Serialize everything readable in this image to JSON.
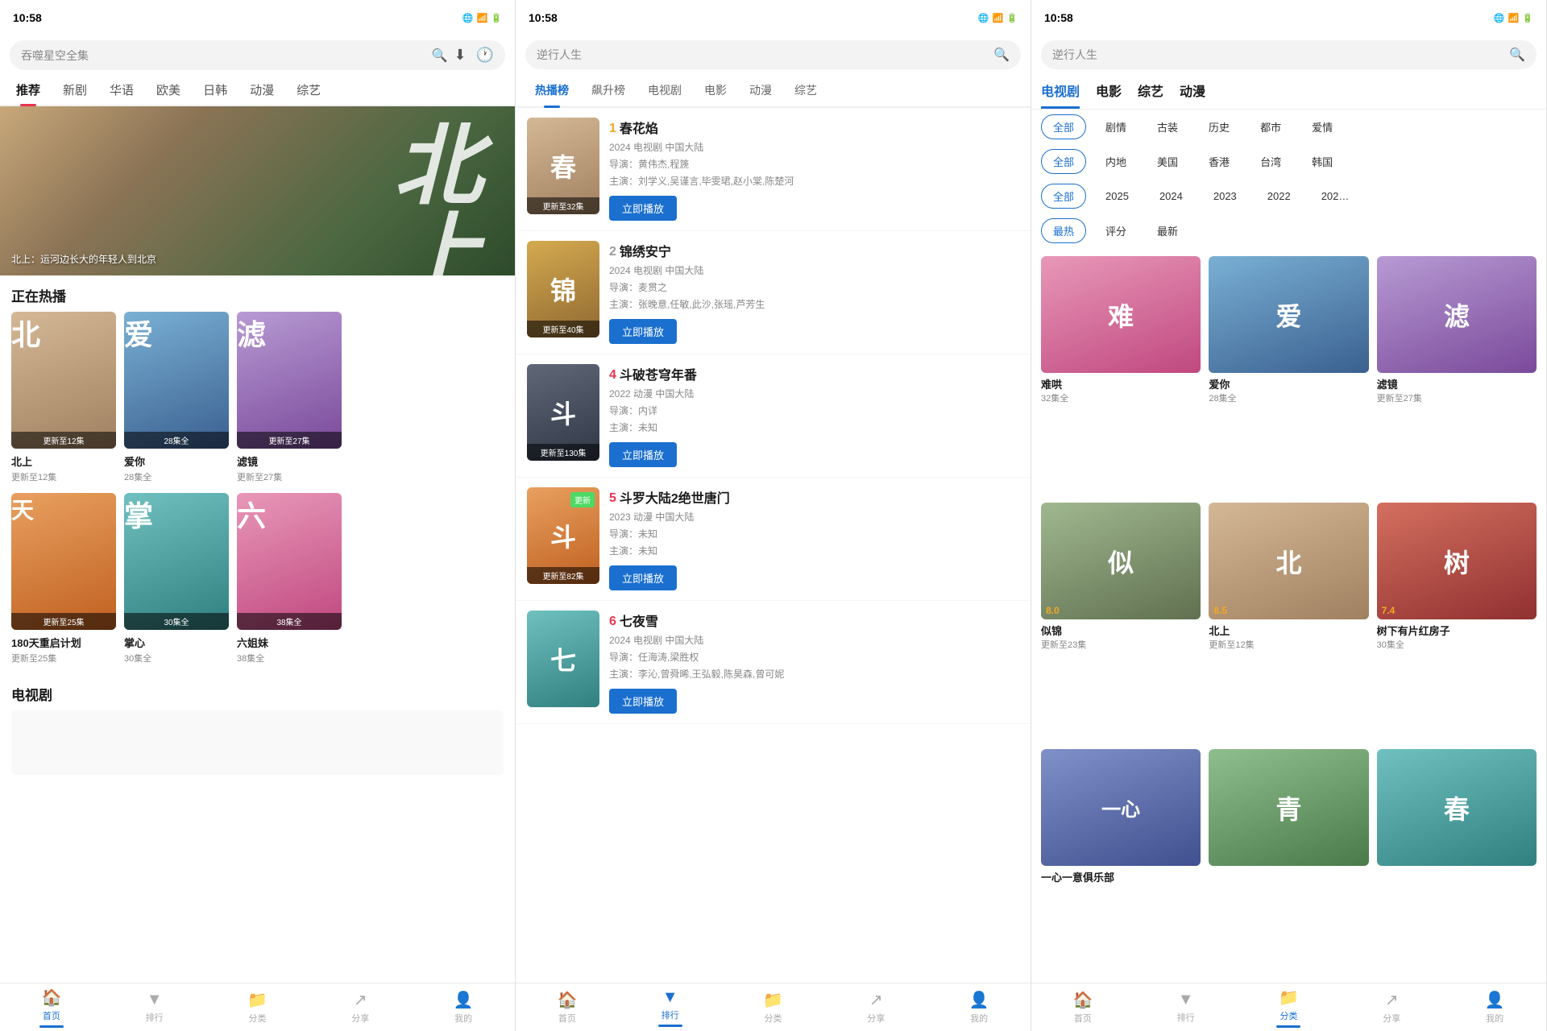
{
  "panels": [
    {
      "id": "home",
      "statusTime": "10:58",
      "searchPlaceholder": "吞噬星空全集",
      "tabs": [
        "推荐",
        "新剧",
        "华语",
        "欧美",
        "日韩",
        "动漫",
        "综艺"
      ],
      "activeTab": 0,
      "heroBigChar": "北上",
      "heroSubtitle": "北上：运河边长大的年轻人到北京",
      "nowPlaying": "正在热播",
      "hotShows": [
        {
          "title": "北上",
          "sub": "更新至12集",
          "color": "img-beige",
          "char": "北"
        },
        {
          "title": "爱你",
          "sub": "28集全",
          "color": "img-blue",
          "char": "爱"
        },
        {
          "title": "滤镜",
          "sub": "更新至27集",
          "color": "img-purple",
          "char": "滤"
        }
      ],
      "hotShows2": [
        {
          "title": "180天重启计划",
          "sub": "更新至25集",
          "color": "img-orange",
          "char": "天"
        },
        {
          "title": "掌心",
          "sub": "30集全",
          "color": "img-teal",
          "char": "掌"
        },
        {
          "title": "六姐妹",
          "sub": "38集全",
          "color": "img-pink",
          "char": "六"
        }
      ],
      "tvSection": "电视剧",
      "bottomNav": [
        {
          "icon": "🏠",
          "label": "首页",
          "active": true
        },
        {
          "icon": "📊",
          "label": "排行",
          "active": false
        },
        {
          "icon": "📁",
          "label": "分类",
          "active": false
        },
        {
          "icon": "↗",
          "label": "分享",
          "active": false
        },
        {
          "icon": "👤",
          "label": "我的",
          "active": false
        }
      ]
    },
    {
      "id": "rank",
      "statusTime": "10:58",
      "searchPlaceholder": "逆行人生",
      "rankTabs": [
        "热播榜",
        "飙升榜",
        "电视剧",
        "电影",
        "动漫",
        "综艺"
      ],
      "activeRankTab": 0,
      "items": [
        {
          "rank": "1",
          "title": "春花焰",
          "meta1": "2024  电视剧  中国大陆",
          "meta2": "导演：黄伟杰,程篪",
          "meta3": "主演：刘学义,吴谨言,毕雯珺,赵小棠,陈楚河",
          "updateBadge": "更新至32集",
          "color": "img-beige",
          "char": "春",
          "btnLabel": "立即播放"
        },
        {
          "rank": "2",
          "title": "锦绣安宁",
          "meta1": "2024  电视剧  中国大陆",
          "meta2": "导演：麦贯之",
          "meta3": "主演：张晚意,任敏,此沙,张瑶,芦芳生",
          "updateBadge": "更新至40集",
          "color": "img-gold",
          "char": "锦",
          "btnLabel": "立即播放"
        },
        {
          "rank": "4",
          "title": "斗破苍穹年番",
          "meta1": "2022  动漫  中国大陆",
          "meta2": "导演：内详",
          "meta3": "主演：未知",
          "updateBadge": "更新至130集",
          "color": "img-dark",
          "char": "斗",
          "btnLabel": "立即播放"
        },
        {
          "rank": "5",
          "title": "斗罗大陆2绝世唐门",
          "meta1": "2023  动漫  中国大陆",
          "meta2": "导演：未知",
          "meta3": "主演：未知",
          "updateBadge": "更新至82集",
          "color": "img-orange",
          "char": "斗",
          "newBadge": "更新",
          "btnLabel": "立即播放"
        },
        {
          "rank": "6",
          "title": "七夜雪",
          "meta1": "2024  电视剧  中国大陆",
          "meta2": "导演：任海涛,梁胜权",
          "meta3": "主演：李沁,曾舜晞,王弘毅,陈昊森,曾可妮",
          "updateBadge": "",
          "color": "img-teal",
          "char": "七",
          "btnLabel": "立即播放"
        }
      ],
      "bottomNav": [
        {
          "icon": "🏠",
          "label": "首页",
          "active": false
        },
        {
          "icon": "📊",
          "label": "排行",
          "active": true
        },
        {
          "icon": "📁",
          "label": "分类",
          "active": false
        },
        {
          "icon": "↗",
          "label": "分享",
          "active": false
        },
        {
          "icon": "👤",
          "label": "我的",
          "active": false
        }
      ]
    },
    {
      "id": "category",
      "statusTime": "10:58",
      "searchPlaceholder": "逆行人生",
      "topTabs": [
        "电视剧",
        "电影",
        "综艺",
        "动漫"
      ],
      "activeTopTab": 0,
      "filterRows": [
        {
          "selected": "全部",
          "items": [
            "全部",
            "剧情",
            "古装",
            "历史",
            "都市",
            "爱情"
          ]
        },
        {
          "selected": "全部",
          "items": [
            "全部",
            "内地",
            "美国",
            "香港",
            "台湾",
            "韩国"
          ]
        },
        {
          "selected": "全部",
          "items": [
            "全部",
            "2025",
            "2024",
            "2023",
            "2022",
            "202…"
          ]
        },
        {
          "selected": "最热",
          "items": [
            "最热",
            "评分",
            "最新"
          ]
        }
      ],
      "shows": [
        {
          "title": "难哄",
          "sub": "32集全",
          "color": "img-pink",
          "char": "难",
          "score": ""
        },
        {
          "title": "爱你",
          "sub": "28集全",
          "color": "img-blue",
          "char": "爱",
          "score": ""
        },
        {
          "title": "滤镜",
          "sub": "更新至27集",
          "color": "img-purple",
          "char": "滤",
          "score": ""
        },
        {
          "title": "似锦",
          "sub": "更新至23集",
          "color": "img-sage",
          "char": "似",
          "score": "8.0"
        },
        {
          "title": "北上",
          "sub": "更新至12集",
          "color": "img-beige",
          "char": "北",
          "score": "8.5"
        },
        {
          "title": "树下有片红房子",
          "sub": "30集全",
          "color": "img-red",
          "char": "树",
          "score": "7.4"
        },
        {
          "title": "一心一意俱乐部",
          "sub": "",
          "color": "img-indigo",
          "char": "一",
          "score": ""
        },
        {
          "title": "",
          "sub": "",
          "color": "img-green",
          "char": "青",
          "score": ""
        },
        {
          "title": "",
          "sub": "",
          "color": "img-teal",
          "char": "春",
          "score": ""
        }
      ],
      "bottomNav": [
        {
          "icon": "🏠",
          "label": "首页",
          "active": false
        },
        {
          "icon": "📊",
          "label": "排行",
          "active": false
        },
        {
          "icon": "📁",
          "label": "分类",
          "active": true
        },
        {
          "icon": "↗",
          "label": "分享",
          "active": false
        },
        {
          "icon": "👤",
          "label": "我的",
          "active": false
        }
      ]
    }
  ]
}
